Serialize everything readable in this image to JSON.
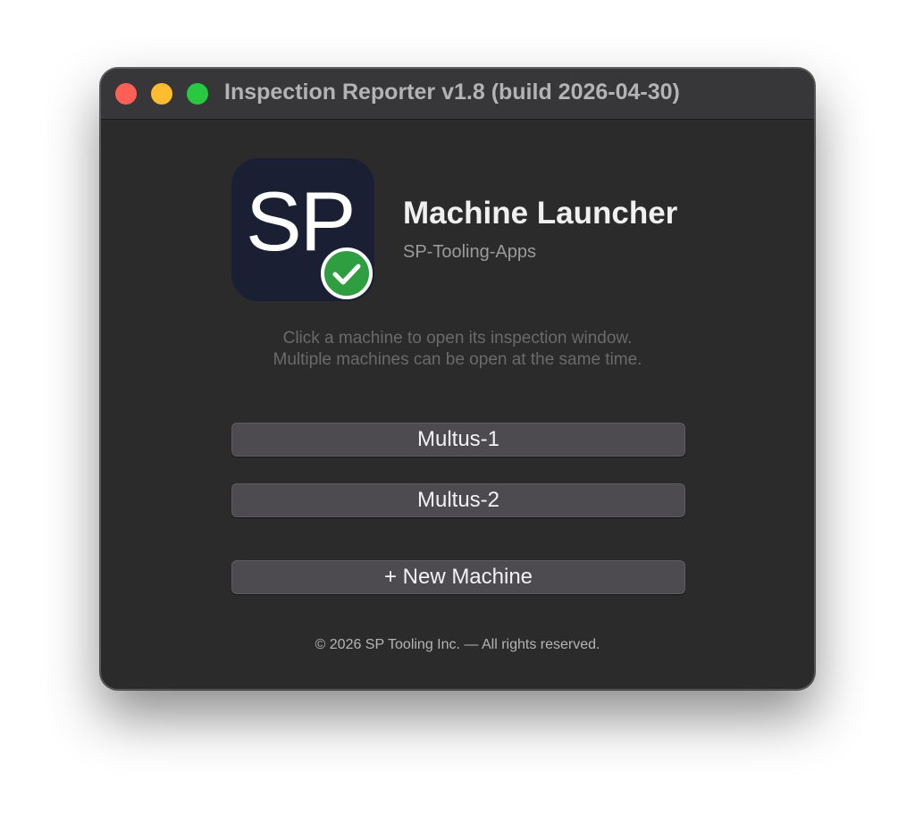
{
  "window": {
    "title": "Inspection Reporter v1.8 (build 2026-04-30)",
    "controls": [
      "close",
      "minimize",
      "maximize"
    ]
  },
  "app": {
    "icon_text": "SP",
    "icon_badge": "check-circle-icon",
    "name": "Machine Launcher",
    "org": "SP-Tooling-Apps"
  },
  "instructions": {
    "line1": "Click a machine to open its inspection window.",
    "line2": "Multiple machines can be open at the same time."
  },
  "machines": [
    {
      "label": "Multus-1"
    },
    {
      "label": "Multus-2"
    }
  ],
  "new_machine_label": "+ New Machine",
  "footer": "© 2026 SP Tooling Inc. — All rights reserved.",
  "colors": {
    "close": "#fe5f57",
    "minimize": "#febc2e",
    "maximize": "#28c840",
    "badge": "#2e9e41"
  }
}
